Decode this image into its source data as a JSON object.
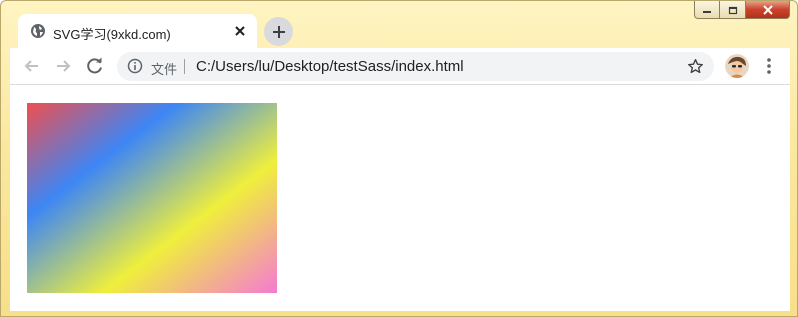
{
  "tab": {
    "title": "SVG学习(9xkd.com)",
    "favicon": "globe-icon"
  },
  "toolbar": {
    "scheme_label": "文件",
    "url": "C:/Users/lu/Desktop/testSass/index.html"
  },
  "content": {
    "gradient_colors": [
      "#ef4f4f",
      "#3d86f5",
      "#efef3c",
      "#f57ad2"
    ]
  }
}
